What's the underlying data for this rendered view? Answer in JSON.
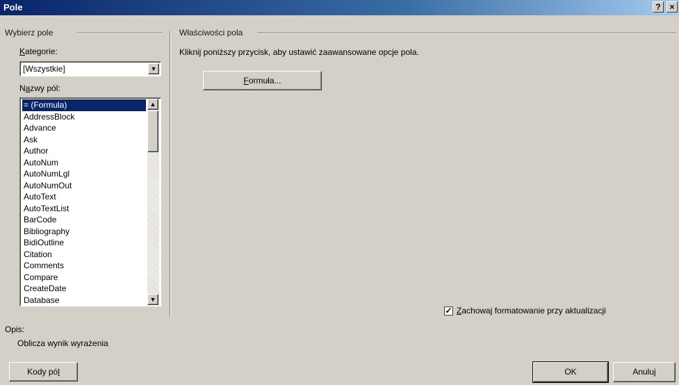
{
  "window": {
    "title": "Pole",
    "help_label": "?",
    "close_label": "×"
  },
  "left_group": {
    "label": "Wybierz pole",
    "category_label": {
      "pre": "",
      "key": "K",
      "post": "ategorie:"
    },
    "category_value": "[Wszystkie]",
    "names_label": {
      "pre": "N",
      "key": "a",
      "post": "zwy pól:"
    },
    "field_names": [
      "= (Formula)",
      "AddressBlock",
      "Advance",
      "Ask",
      "Author",
      "AutoNum",
      "AutoNumLgl",
      "AutoNumOut",
      "AutoText",
      "AutoTextList",
      "BarCode",
      "Bibliography",
      "BidiOutline",
      "Citation",
      "Comments",
      "Compare",
      "CreateDate",
      "Database"
    ],
    "selected_index": 0
  },
  "right_group": {
    "label": "Właściwości pola",
    "instruction": "Kliknij poniższy przycisk, aby ustawić zaawansowane opcje pola.",
    "formula_button": {
      "pre": "",
      "key": "F",
      "post": "ormuła..."
    },
    "preserve_checkbox": {
      "checked": true,
      "pre": "",
      "key": "Z",
      "post": "achowaj formatowanie przy aktualizacji"
    }
  },
  "description": {
    "label": "Opis:",
    "text": "Oblicza wynik wyrażenia"
  },
  "footer": {
    "field_codes_button": {
      "pre": "Kody pó",
      "key": "l",
      "post": ""
    },
    "ok_label": "OK",
    "cancel_label": "Anuluj"
  },
  "colors": {
    "title_start": "#0a246a",
    "title_end": "#a6caf0",
    "selection": "#0a246a",
    "face": "#d4d0c8"
  }
}
